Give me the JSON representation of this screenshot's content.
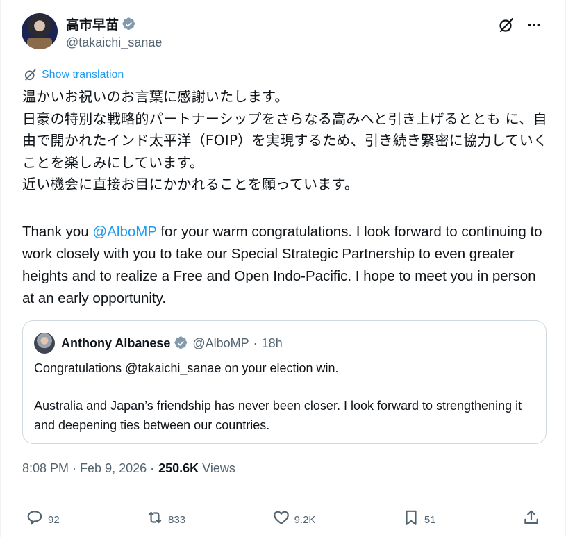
{
  "author": {
    "display_name": "高市早苗",
    "handle": "@takaichi_sanae"
  },
  "translate_label": "Show translation",
  "text_jp": [
    "温かいお祝いのお言葉に感謝いたします。",
    "日豪の特別な戦略的パートナーシップをさらなる高みへと引き上げるととも に、自由で開かれたインド太平洋（FOIP）を実現するため、引き続き緊密に協力していくことを楽しみにしています。",
    "近い機会に直接お目にかかれることを願っています。"
  ],
  "text_en": {
    "prefix": "Thank you ",
    "mention": "@AlboMP",
    "suffix": " for your warm congratulations. I look forward to continuing to work closely with you to take our Special Strategic Partnership to even greater heights and to realize a Free and Open Indo-Pacific. I hope to meet you in person at an early opportunity."
  },
  "quote": {
    "display_name": "Anthony Albanese",
    "handle": "@AlboMP",
    "separator": "·",
    "time": "18h",
    "body": [
      "Congratulations @takaichi_sanae on your election win.",
      "Australia and Japan’s friendship has never been closer. I look forward to strengthening it and deepening ties between our countries."
    ]
  },
  "meta": {
    "time": "8:08 PM",
    "sep1": "·",
    "date": "Feb 9, 2026",
    "sep2": "·",
    "views_count": "250.6K",
    "views_label": "Views"
  },
  "actions": {
    "replies": "92",
    "reposts": "833",
    "likes": "9.2K",
    "bookmarks": "51"
  },
  "colors": {
    "accent": "#1d9bf0",
    "text": "#0f1419",
    "muted": "#536471",
    "border": "#cfd9de"
  },
  "icons": {
    "translate": "grok-translate-icon",
    "more": "more-icon",
    "reply": "reply-icon",
    "repost": "repost-icon",
    "like": "heart-icon",
    "bookmark": "bookmark-icon",
    "share": "share-icon",
    "verified": "verified-badge-icon"
  }
}
